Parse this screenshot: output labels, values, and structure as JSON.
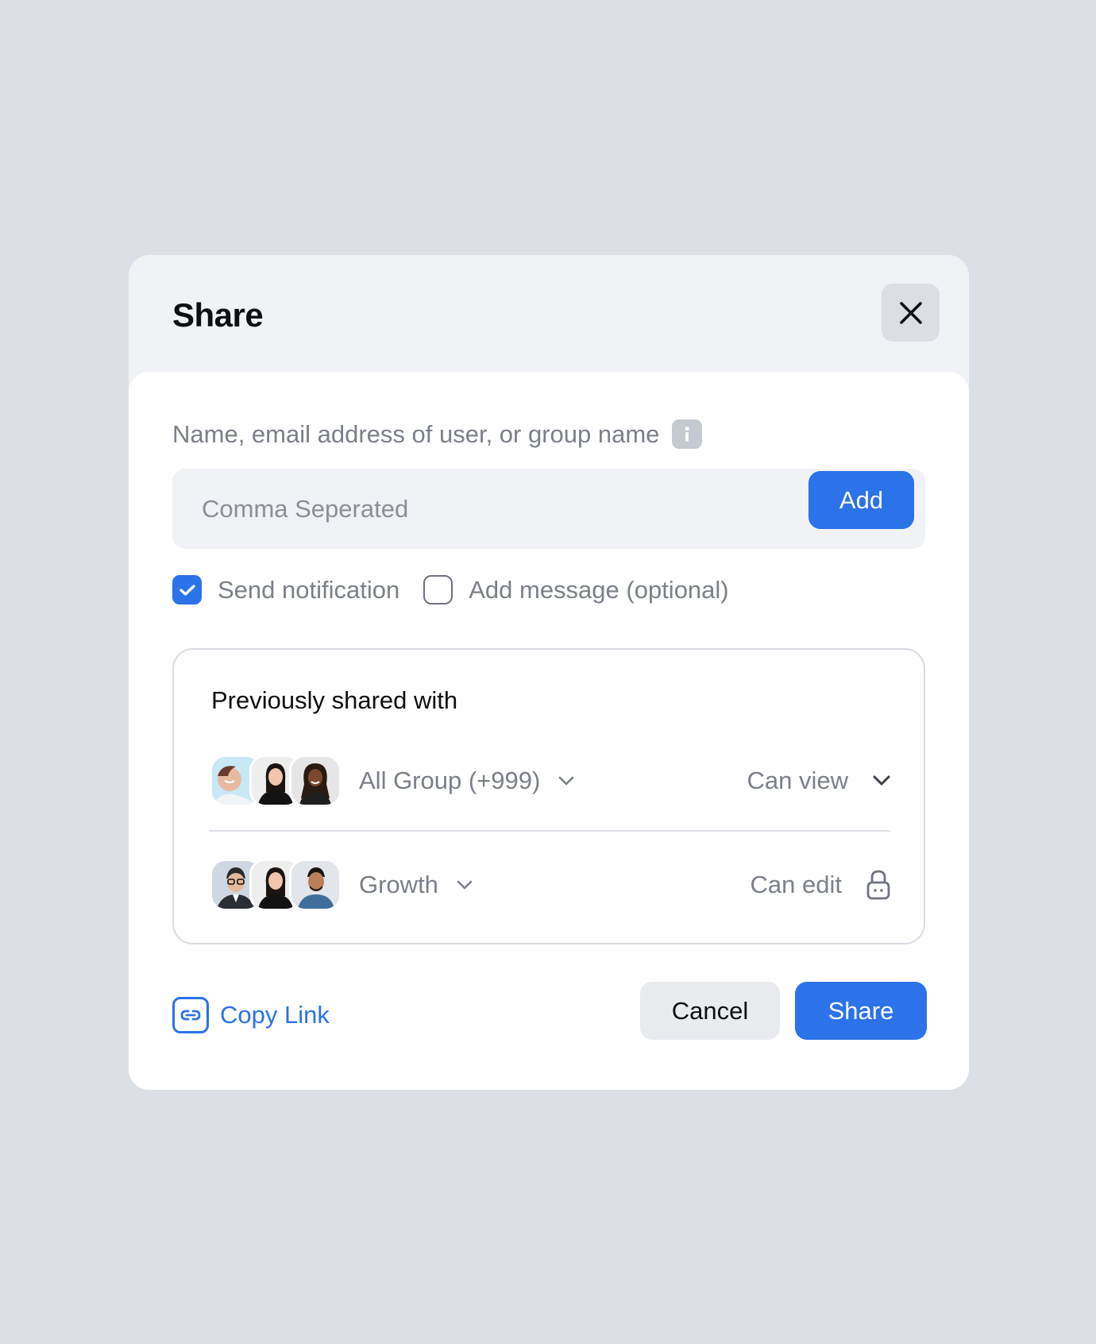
{
  "dialog": {
    "title": "Share",
    "close_icon": "close-icon"
  },
  "recipient_field": {
    "label": "Name, email address of user, or group name",
    "info_icon": "info-icon",
    "placeholder": "Comma Seperated",
    "value": "",
    "add_label": "Add"
  },
  "options": {
    "send_notification": {
      "label": "Send notification",
      "checked": true
    },
    "add_message": {
      "label": "Add message (optional)",
      "checked": false
    }
  },
  "previously_shared": {
    "title": "Previously shared with",
    "entries": [
      {
        "group": "All Group (+999)",
        "permission": "Can view",
        "permission_control": "chevron-down-icon",
        "avatars": [
          "avatar-1",
          "avatar-2",
          "avatar-3"
        ]
      },
      {
        "group": "Growth",
        "permission": "Can edit",
        "permission_control": "lock-icon",
        "avatars": [
          "avatar-1",
          "avatar-2",
          "avatar-3"
        ]
      }
    ]
  },
  "footer": {
    "copy_link_label": "Copy Link",
    "copy_link_icon": "link-icon",
    "cancel_label": "Cancel",
    "share_label": "Share"
  },
  "colors": {
    "background": "#dcdfe6",
    "accent": "#2c72e8",
    "muted_text": "#7b7f89",
    "header_bg": "#f1f2f6"
  }
}
